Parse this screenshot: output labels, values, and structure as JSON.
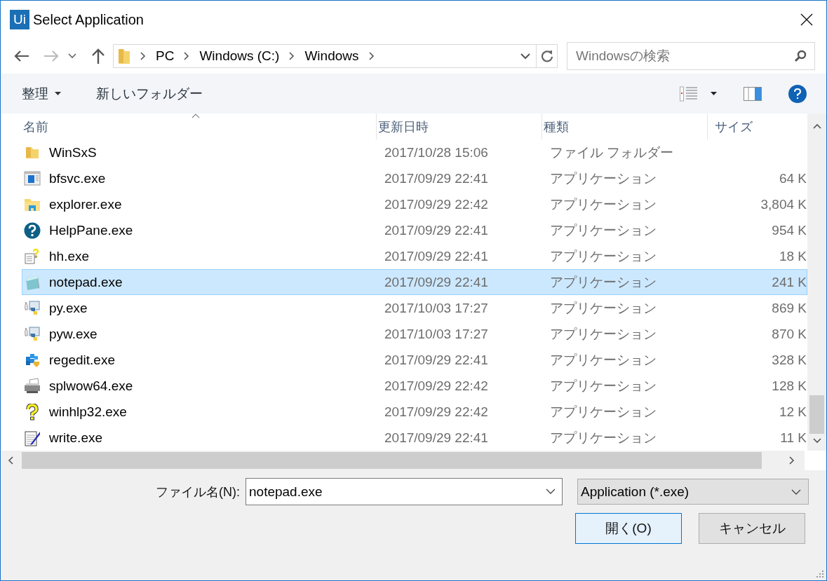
{
  "window": {
    "app_badge": "Ui",
    "title": "Select Application"
  },
  "address_bar": {
    "segments": [
      "PC",
      "Windows (C:)",
      "Windows"
    ]
  },
  "search": {
    "placeholder": "Windowsの検索"
  },
  "toolbar": {
    "organize": "整理",
    "new_folder": "新しいフォルダー"
  },
  "table": {
    "columns": [
      "名前",
      "更新日時",
      "種類",
      "サイズ"
    ],
    "rows": [
      {
        "kind": "folder",
        "name": "WinSxS",
        "modified": "2017/10/28 15:06",
        "type": "ファイル フォルダー",
        "size": "",
        "selected": false
      },
      {
        "kind": "window",
        "name": "bfsvc.exe",
        "modified": "2017/09/29 22:41",
        "type": "アプリケーション",
        "size": "64 K",
        "selected": false
      },
      {
        "kind": "explorer",
        "name": "explorer.exe",
        "modified": "2017/09/29 22:42",
        "type": "アプリケーション",
        "size": "3,804 K",
        "selected": false
      },
      {
        "kind": "help",
        "name": "HelpPane.exe",
        "modified": "2017/09/29 22:41",
        "type": "アプリケーション",
        "size": "954 K",
        "selected": false
      },
      {
        "kind": "helpdoc",
        "name": "hh.exe",
        "modified": "2017/09/29 22:41",
        "type": "アプリケーション",
        "size": "18 K",
        "selected": false
      },
      {
        "kind": "notepad",
        "name": "notepad.exe",
        "modified": "2017/09/29 22:41",
        "type": "アプリケーション",
        "size": "241 K",
        "selected": true
      },
      {
        "kind": "python",
        "name": "py.exe",
        "modified": "2017/10/03 17:27",
        "type": "アプリケーション",
        "size": "869 K",
        "selected": false
      },
      {
        "kind": "python",
        "name": "pyw.exe",
        "modified": "2017/10/03 17:27",
        "type": "アプリケーション",
        "size": "870 K",
        "selected": false
      },
      {
        "kind": "registry",
        "name": "regedit.exe",
        "modified": "2017/09/29 22:41",
        "type": "アプリケーション",
        "size": "328 K",
        "selected": false
      },
      {
        "kind": "printer",
        "name": "splwow64.exe",
        "modified": "2017/09/29 22:42",
        "type": "アプリケーション",
        "size": "128 K",
        "selected": false
      },
      {
        "kind": "question",
        "name": "winhlp32.exe",
        "modified": "2017/09/29 22:42",
        "type": "アプリケーション",
        "size": "12 K",
        "selected": false
      },
      {
        "kind": "write",
        "name": "write.exe",
        "modified": "2017/09/29 22:41",
        "type": "アプリケーション",
        "size": "11 K",
        "selected": false
      }
    ]
  },
  "file_name": {
    "label": "ファイル名(N):",
    "value": "notepad.exe"
  },
  "file_type": {
    "value": "Application (*.exe)"
  },
  "buttons": [
    {
      "kind": "default",
      "label": "開く(O)"
    },
    {
      "kind": "normal",
      "label": "キャンセル"
    }
  ]
}
